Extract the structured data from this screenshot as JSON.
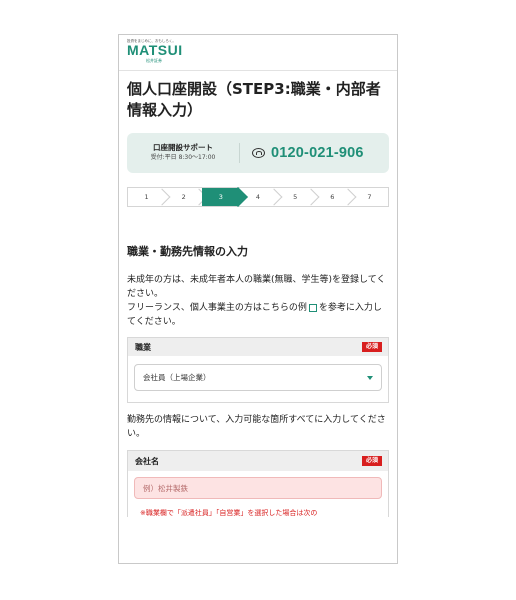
{
  "header": {
    "tagline": "投資をまじめに、おもしろく。",
    "logo": "MATSUI",
    "logo_sub": "松井証券"
  },
  "page_title": "個人口座開設（STEP3:職業・内部者情報入力）",
  "support": {
    "title": "口座開設サポート",
    "hours": "受付:平日 8:30〜17:00",
    "phone": "0120-021-906"
  },
  "steps": [
    "1",
    "2",
    "3",
    "4",
    "5",
    "6",
    "7"
  ],
  "current_step": "3",
  "section": {
    "title": "職業・勤務先情報の入力",
    "para1": "未成年の方は、未成年者本人の職業(無職、学生等)を登録してください。",
    "para2_a": "フリーランス、個人事業主の方はこちらの例",
    "para2_b": "を参考に入力してください。",
    "para3": "勤務先の情報について、入力可能な箇所すべてに入力してください。"
  },
  "occupation": {
    "label": "職業",
    "required": "必須",
    "selected": "会社員（上場企業）"
  },
  "company": {
    "label": "会社名",
    "required": "必須",
    "placeholder": "例）松井製鉄",
    "note": "※職業欄で「派遣社員」「自営業」を選択した場合は次の"
  },
  "colors": {
    "accent": "#1f8f77",
    "required": "#d81e1e",
    "error_bg": "#fde3e3"
  }
}
